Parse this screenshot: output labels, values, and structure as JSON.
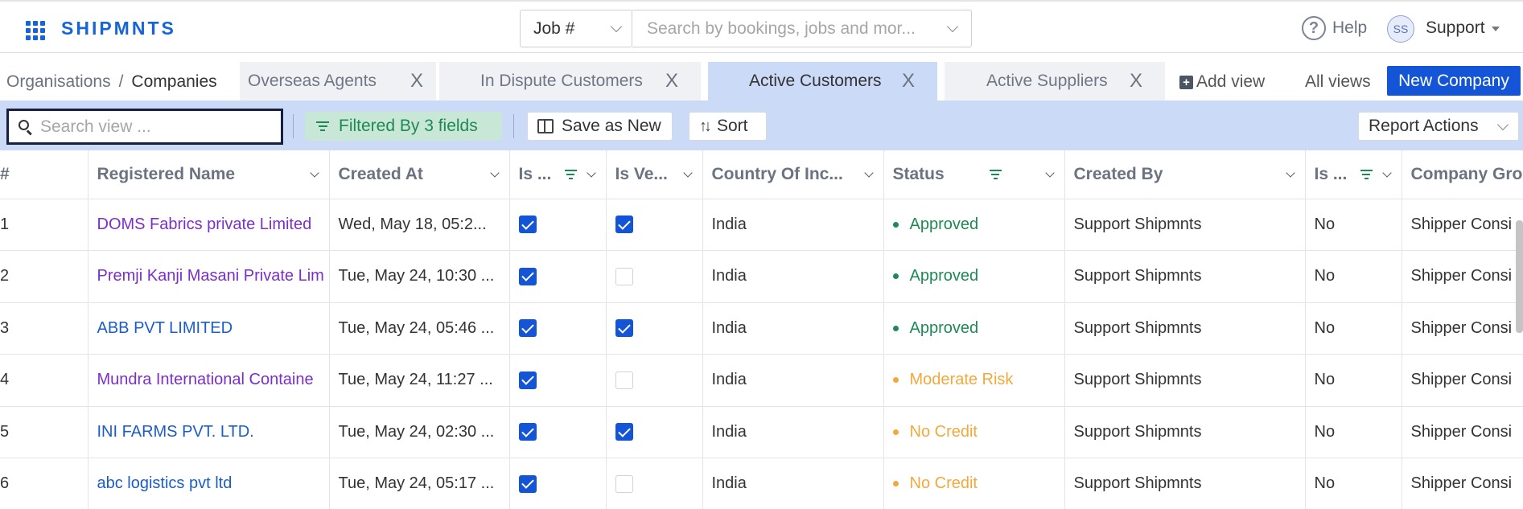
{
  "header": {
    "logo": "SHIPMNTS",
    "job_select": "Job #",
    "search_placeholder": "Search by bookings, jobs and mor...",
    "help": "Help",
    "avatar_initials": "SS",
    "user_name": "Support"
  },
  "breadcrumb": {
    "parent": "Organisations",
    "separator": "/",
    "current": "Companies"
  },
  "tabs": [
    {
      "label": "Overseas Agents",
      "active": false
    },
    {
      "label": "In Dispute Customers",
      "active": false
    },
    {
      "label": "Active Customers",
      "active": true
    },
    {
      "label": "Active Suppliers",
      "active": false
    }
  ],
  "tab_close": "X",
  "add_view": "Add view",
  "all_views": "All views",
  "new_company": "New Company",
  "toolbar": {
    "search_placeholder": "Search view ...",
    "filter": "Filtered By 3 fields",
    "save_as_new": "Save as New",
    "sort": "Sort",
    "report_actions": "Report Actions"
  },
  "columns": {
    "index": "#",
    "registered_name": "Registered Name",
    "created_at": "Created At",
    "is_1": "Is ...",
    "is_ve": "Is Ve...",
    "country": "Country Of Inc...",
    "status": "Status",
    "created_by": "Created By",
    "is_2": "Is ...",
    "company_group": "Company Gro"
  },
  "colors": {
    "brand": "#1565d8",
    "approved": "#1d8a55",
    "warning": "#f2a93b",
    "purple_link": "#7b2fc9",
    "blue_link": "#1a5dc8"
  },
  "rows": [
    {
      "index": "1",
      "name": "DOMS Fabrics private Limited",
      "name_color": "purple",
      "created_at": "Wed, May 18, 05:2...",
      "is_1": true,
      "is_ve": true,
      "country": "India",
      "status": "Approved",
      "status_type": "approved",
      "created_by": "Support Shipmnts",
      "is_2": "No",
      "group": "Shipper Consi"
    },
    {
      "index": "2",
      "name": "Premji Kanji Masani Private Lim",
      "name_color": "purple",
      "created_at": "Tue, May 24, 10:30 ...",
      "is_1": true,
      "is_ve": false,
      "country": "India",
      "status": "Approved",
      "status_type": "approved",
      "created_by": "Support Shipmnts",
      "is_2": "No",
      "group": "Shipper Consi"
    },
    {
      "index": "3",
      "name": "ABB PVT LIMITED",
      "name_color": "blue",
      "created_at": "Tue, May 24, 05:46 ...",
      "is_1": true,
      "is_ve": true,
      "country": "India",
      "status": "Approved",
      "status_type": "approved",
      "created_by": "Support Shipmnts",
      "is_2": "No",
      "group": "Shipper Consi"
    },
    {
      "index": "4",
      "name": "Mundra International Containe",
      "name_color": "purple",
      "created_at": "Tue, May 24, 11:27 ...",
      "is_1": true,
      "is_ve": false,
      "country": "India",
      "status": "Moderate Risk",
      "status_type": "warning",
      "created_by": "Support Shipmnts",
      "is_2": "No",
      "group": "Shipper Consi"
    },
    {
      "index": "5",
      "name": "INI FARMS PVT. LTD.",
      "name_color": "blue",
      "created_at": "Tue, May 24, 02:30 ...",
      "is_1": true,
      "is_ve": true,
      "country": "India",
      "status": "No Credit",
      "status_type": "warning",
      "created_by": "Support Shipmnts",
      "is_2": "No",
      "group": "Shipper Consi"
    },
    {
      "index": "6",
      "name": "abc logistics pvt ltd",
      "name_color": "blue",
      "created_at": "Tue, May 24, 05:17 ...",
      "is_1": true,
      "is_ve": false,
      "country": "India",
      "status": "No Credit",
      "status_type": "warning",
      "created_by": "Support Shipmnts",
      "is_2": "No",
      "group": "Shipper Consi"
    }
  ]
}
